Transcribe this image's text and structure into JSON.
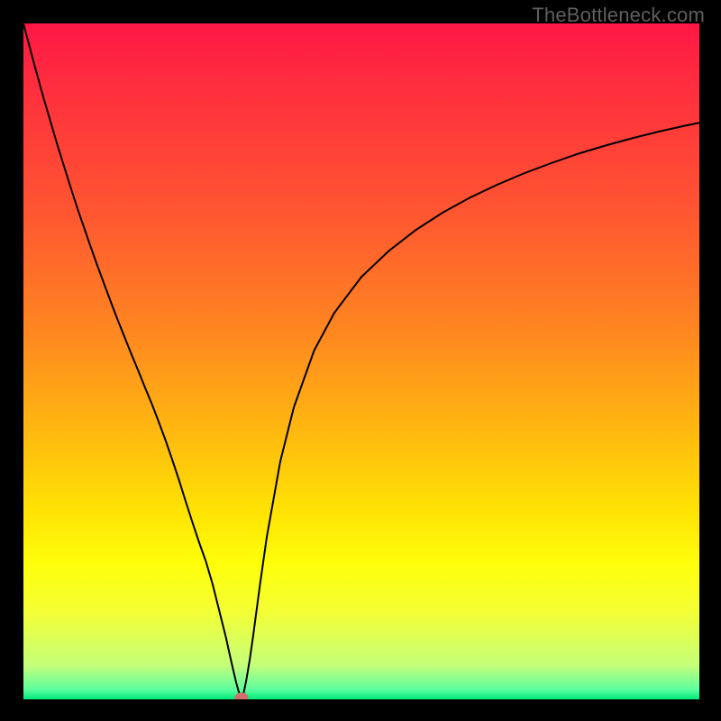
{
  "watermark": {
    "text": "TheBottleneck.com"
  },
  "chart": {
    "inner_width": 750,
    "inner_height": 750,
    "border_px": 26
  },
  "gradient": {
    "stops": [
      {
        "color": "#ff1745",
        "pos": 0
      },
      {
        "color": "#ff2b3f",
        "pos": 8
      },
      {
        "color": "#ff5631",
        "pos": 28
      },
      {
        "color": "#ff8820",
        "pos": 46
      },
      {
        "color": "#ffb710",
        "pos": 60
      },
      {
        "color": "#ffe204",
        "pos": 72
      },
      {
        "color": "#feff0b",
        "pos": 80
      },
      {
        "color": "#f4ff34",
        "pos": 87
      },
      {
        "color": "#c4ff7a",
        "pos": 95
      },
      {
        "color": "#5eff9f",
        "pos": 98.5
      },
      {
        "color": "#00e97b",
        "pos": 100
      }
    ]
  },
  "chart_data": {
    "type": "line",
    "title": "",
    "xlabel": "",
    "ylabel": "",
    "x": [
      0.0,
      0.01,
      0.02,
      0.03,
      0.04,
      0.05,
      0.06,
      0.07,
      0.08,
      0.09,
      0.1,
      0.11,
      0.12,
      0.13,
      0.14,
      0.15,
      0.16,
      0.17,
      0.18,
      0.19,
      0.2,
      0.21,
      0.22,
      0.23,
      0.24,
      0.25,
      0.26,
      0.27,
      0.28,
      0.29,
      0.3,
      0.305,
      0.31,
      0.315,
      0.318,
      0.32,
      0.321,
      0.322,
      0.324,
      0.326,
      0.33,
      0.335,
      0.34,
      0.35,
      0.36,
      0.38,
      0.4,
      0.43,
      0.46,
      0.5,
      0.54,
      0.58,
      0.62,
      0.66,
      0.7,
      0.74,
      0.78,
      0.82,
      0.86,
      0.9,
      0.94,
      0.98,
      1.0
    ],
    "values": [
      1.0,
      0.962,
      0.925,
      0.889,
      0.855,
      0.821,
      0.789,
      0.757,
      0.726,
      0.697,
      0.668,
      0.64,
      0.613,
      0.586,
      0.56,
      0.535,
      0.51,
      0.486,
      0.461,
      0.437,
      0.411,
      0.384,
      0.355,
      0.325,
      0.293,
      0.262,
      0.232,
      0.204,
      0.17,
      0.13,
      0.09,
      0.067,
      0.045,
      0.024,
      0.013,
      0.007,
      0.004,
      0.003,
      0.004,
      0.01,
      0.03,
      0.06,
      0.095,
      0.17,
      0.24,
      0.352,
      0.432,
      0.516,
      0.572,
      0.625,
      0.663,
      0.694,
      0.72,
      0.742,
      0.761,
      0.778,
      0.793,
      0.807,
      0.819,
      0.83,
      0.84,
      0.849,
      0.853
    ],
    "xlim": [
      0,
      1
    ],
    "ylim": [
      0,
      1
    ],
    "minimum_marker": {
      "x": 0.322,
      "y": 0.003
    }
  },
  "curve_style": {
    "stroke": "#000000",
    "width": 2
  },
  "marker_style": {
    "fill": "#d46e6e"
  }
}
